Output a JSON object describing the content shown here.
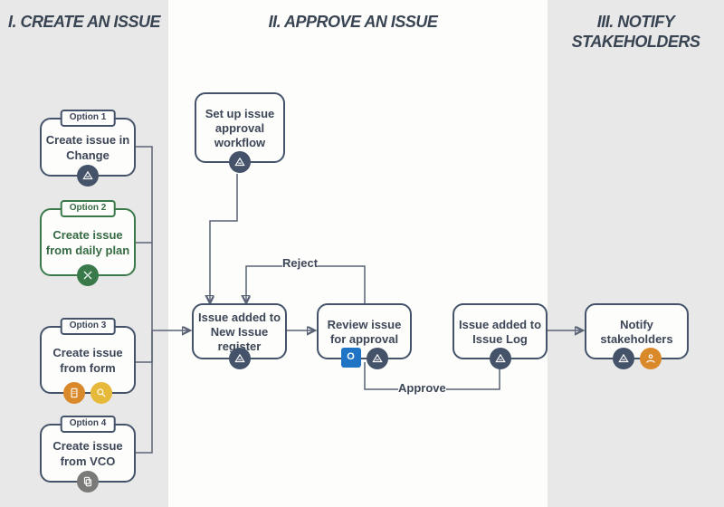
{
  "sections": {
    "s1": "I. CREATE AN ISSUE",
    "s2": "II. APPROVE AN ISSUE",
    "s3": "III. NOTIFY STAKEHOLDERS"
  },
  "nodes": {
    "opt1": {
      "tag": "Option 1",
      "text": "Create issue in Change"
    },
    "opt2": {
      "tag": "Option 2",
      "text": "Create issue from daily plan"
    },
    "opt3": {
      "tag": "Option 3",
      "text": "Create issue from form"
    },
    "opt4": {
      "tag": "Option 4",
      "text": "Create issue from VCO"
    },
    "setup": "Set up issue approval workflow",
    "newreg": "Issue added to New Issue register",
    "review": "Review issue for approval",
    "log": "Issue added to Issue Log",
    "notify": "Notify stakeholders"
  },
  "labels": {
    "reject": "Reject",
    "approve": "Approve"
  },
  "icons": {
    "triangle": "triangle-icon",
    "tools": "tools-icon",
    "doc": "document-icon",
    "search": "search-icon",
    "copy": "copy-icon",
    "outlook": "outlook-icon",
    "person": "person-icon"
  }
}
